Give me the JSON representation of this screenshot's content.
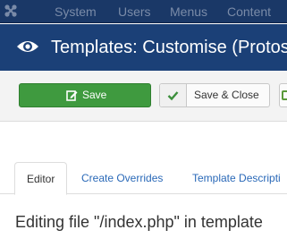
{
  "navbar": {
    "logo_icon": "joomla-logo-icon",
    "items": [
      {
        "label": "System"
      },
      {
        "label": "Users"
      },
      {
        "label": "Menus"
      },
      {
        "label": "Content"
      }
    ]
  },
  "header": {
    "icon": "eye-icon",
    "title": "Templates: Customise (Protos"
  },
  "toolbar": {
    "save_label": "Save",
    "save_icon": "edit-icon",
    "save_close_label": "Save & Close",
    "save_close_icon": "checkmark-icon"
  },
  "tabs": [
    {
      "label": "Editor",
      "active": true
    },
    {
      "label": "Create Overrides",
      "active": false
    },
    {
      "label": "Template Descripti",
      "active": false
    }
  ],
  "main": {
    "editing_heading": "Editing file \"/index.php\" in template"
  },
  "colors": {
    "navbar_bg": "#1a3867",
    "header_bg": "#1b4077",
    "save_green": "#3f9a3f",
    "link_blue": "#2a69b8"
  }
}
